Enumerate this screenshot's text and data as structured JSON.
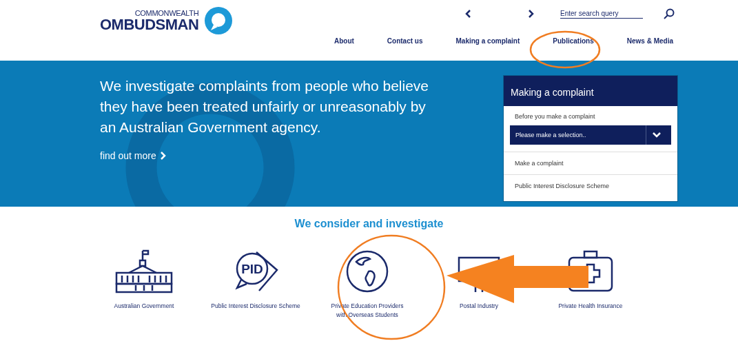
{
  "logo": {
    "line_1": "COMMONWEALTH",
    "line_2": "OMBUDSMAN"
  },
  "search": {
    "placeholder": "Enter search query"
  },
  "nav": [
    {
      "label": "About"
    },
    {
      "label": "Contact us"
    },
    {
      "label": "Making a complaint"
    },
    {
      "label": "Publications"
    },
    {
      "label": "News & Media"
    }
  ],
  "hero": {
    "heading": "We investigate complaints from people who believe they have been treated unfairly or unreasonably by an Australian Government agency.",
    "link": "find out more"
  },
  "complaint_panel": {
    "title": "Making a complaint",
    "label": "Before you make a complaint",
    "select": "Please make a selection..",
    "links": [
      "Make a complaint",
      "Public Interest Disclosure Scheme"
    ]
  },
  "section_title": "We consider and investigate",
  "categories": [
    {
      "kind": "building",
      "label": "Australian Government"
    },
    {
      "kind": "pid",
      "label": "Public Interest Disclosure Scheme",
      "icon_text": "PID"
    },
    {
      "kind": "globe",
      "label": "Private Education Providers with Overseas Students"
    },
    {
      "kind": "postal",
      "label": "Postal Industry"
    },
    {
      "kind": "medical",
      "label": "Private Health Insurance"
    }
  ]
}
